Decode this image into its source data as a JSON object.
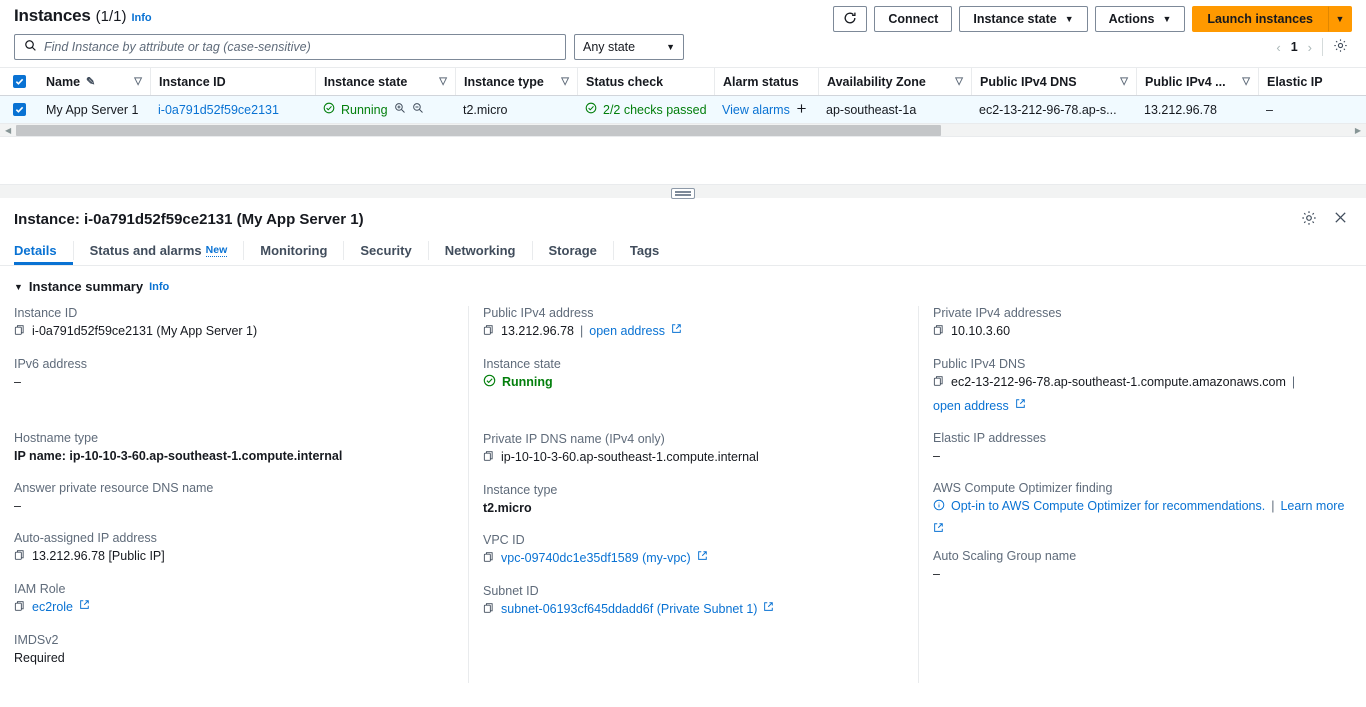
{
  "list": {
    "title": "Instances",
    "count": "(1/1)",
    "info_label": "Info",
    "refresh_icon": "refresh-icon",
    "buttons": {
      "connect": "Connect",
      "instance_state": "Instance state",
      "actions": "Actions",
      "launch": "Launch instances"
    },
    "search_placeholder": "Find Instance by attribute or tag (case-sensitive)",
    "state_filter": "Any state",
    "pagination": {
      "prev": "‹",
      "page": "1",
      "next": "›"
    },
    "settings_icon": "gear-icon",
    "columns": [
      "Name",
      "Instance ID",
      "Instance state",
      "Instance type",
      "Status check",
      "Alarm status",
      "Availability Zone",
      "Public IPv4 DNS",
      "Public IPv4 ...",
      "Elastic IP"
    ],
    "row": {
      "selected": true,
      "name": "My App Server 1",
      "instance_id": "i-0a791d52f59ce2131",
      "instance_state": "Running",
      "instance_type": "t2.micro",
      "status_check": "2/2 checks passed",
      "alarm_status": "View alarms",
      "alarm_add": "+",
      "availability_zone": "ap-southeast-1a",
      "public_ipv4_dns": "ec2-13-212-96-78.ap-s...",
      "public_ipv4": "13.212.96.78",
      "elastic_ip": "–"
    }
  },
  "detail": {
    "title": "Instance: i-0a791d52f59ce2131 (My App Server 1)",
    "preferences_icon": "gear-icon",
    "close_icon": "close-icon",
    "tabs": [
      {
        "label": "Details",
        "badge": "",
        "active": true
      },
      {
        "label": "Status and alarms",
        "badge": "New",
        "active": false
      },
      {
        "label": "Monitoring",
        "badge": "",
        "active": false
      },
      {
        "label": "Security",
        "badge": "",
        "active": false
      },
      {
        "label": "Networking",
        "badge": "",
        "active": false
      },
      {
        "label": "Storage",
        "badge": "",
        "active": false
      },
      {
        "label": "Tags",
        "badge": "",
        "active": false
      }
    ],
    "summary": {
      "section_title": "Instance summary",
      "info_label": "Info",
      "col1": {
        "f1_label": "Instance ID",
        "f1_value": "i-0a791d52f59ce2131 (My App Server 1)",
        "f2_label": "IPv6 address",
        "f2_value": "–",
        "f3_label": "Hostname type",
        "f3_value": "IP name: ip-10-10-3-60.ap-southeast-1.compute.internal",
        "f4_label": "Answer private resource DNS name",
        "f4_value": "–",
        "f5_label": "Auto-assigned IP address",
        "f5_value": "13.212.96.78 [Public IP]",
        "f6_label": "IAM Role",
        "f6_value": "ec2role",
        "f7_label": "IMDSv2",
        "f7_value": "Required"
      },
      "col2": {
        "f1_label": "Public IPv4 address",
        "f1_value": "13.212.96.78",
        "f1_link": "open address",
        "f2_label": "Instance state",
        "f2_value": "Running",
        "f3_label": "Private IP DNS name (IPv4 only)",
        "f3_value": "ip-10-10-3-60.ap-southeast-1.compute.internal",
        "f4_label": "Instance type",
        "f4_value": "t2.micro",
        "f5_label": "VPC ID",
        "f5_value": "vpc-09740dc1e35df1589 (my-vpc)",
        "f6_label": "Subnet ID",
        "f6_value": "subnet-06193cf645ddadd6f (Private Subnet 1)"
      },
      "col3": {
        "f1_label": "Private IPv4 addresses",
        "f1_value": "10.10.3.60",
        "f2_label": "Public IPv4 DNS",
        "f2_value": "ec2-13-212-96-78.ap-southeast-1.compute.amazonaws.com",
        "f2_link": "open address",
        "f3_label": "Elastic IP addresses",
        "f3_value": "–",
        "f4_label": "AWS Compute Optimizer finding",
        "f4_value": "Opt-in to AWS Compute Optimizer for recommendations.",
        "f4_link": "Learn more",
        "f5_label": "Auto Scaling Group name",
        "f5_value": "–"
      }
    }
  },
  "colors": {
    "accent_link": "#0972d3",
    "brand_orange": "#ff9900",
    "status_green": "#037f0c",
    "label_grey": "#5f6b7a",
    "row_selected_bg": "#f1faff"
  }
}
